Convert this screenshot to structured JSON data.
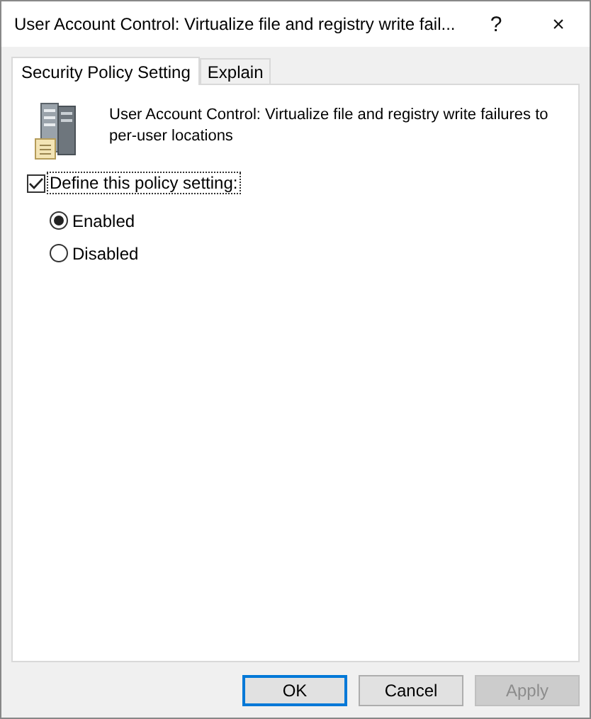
{
  "window": {
    "title": "User Account Control: Virtualize file and registry write fail...",
    "help": "?",
    "close": "×"
  },
  "tabs": [
    {
      "label": "Security Policy Setting",
      "selected": true
    },
    {
      "label": "Explain",
      "selected": false
    }
  ],
  "policy": {
    "description": "User Account Control: Virtualize file and registry write failures to per-user locations"
  },
  "define": {
    "label": "Define this policy setting:",
    "checked": true
  },
  "options": [
    {
      "label": "Enabled",
      "selected": true
    },
    {
      "label": "Disabled",
      "selected": false
    }
  ],
  "buttons": [
    {
      "label": "OK",
      "default": true,
      "disabled": false
    },
    {
      "label": "Cancel",
      "default": false,
      "disabled": false
    },
    {
      "label": "Apply",
      "default": false,
      "disabled": true
    }
  ]
}
